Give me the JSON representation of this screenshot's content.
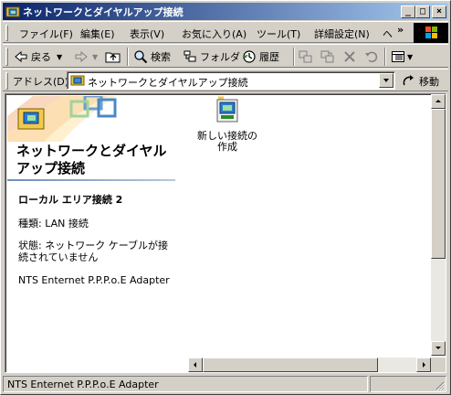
{
  "window": {
    "title": "ネットワークとダイヤルアップ接続"
  },
  "caption_buttons": {
    "minimize": "_",
    "maximize": "□",
    "close": "×"
  },
  "menu": {
    "items": [
      "ファイル(F)",
      "編集(E)",
      "表示(V)",
      "お気に入り(A)",
      "ツール(T)",
      "詳細設定(N)",
      "ヘ"
    ],
    "overflow": "»"
  },
  "toolbar": {
    "back": "戻る",
    "search": "検索",
    "folders": "フォルダ",
    "history": "履歴"
  },
  "address": {
    "label": "アドレス(D)",
    "value": "ネットワークとダイヤルアップ接続",
    "go": "移動"
  },
  "left_pane": {
    "title": "ネットワークとダイヤルアップ接続",
    "connection_name": "ローカル エリア接続 2",
    "type_line": "種類: LAN 接続",
    "status_line": "状態: ネットワーク ケーブルが接続されていません",
    "adapter": "NTS Enternet P.P.P.o.E Adapter"
  },
  "items": [
    {
      "label": "新しい接続の作成",
      "icon": "new-connection-icon"
    }
  ],
  "statusbar": {
    "text": "NTS Enternet P.P.P.o.E Adapter"
  },
  "colors": {
    "titlebar_start": "#0a246a",
    "titlebar_end": "#a6caf0",
    "face": "#d4d0c8",
    "pane_rule": "#6f8fb8"
  }
}
